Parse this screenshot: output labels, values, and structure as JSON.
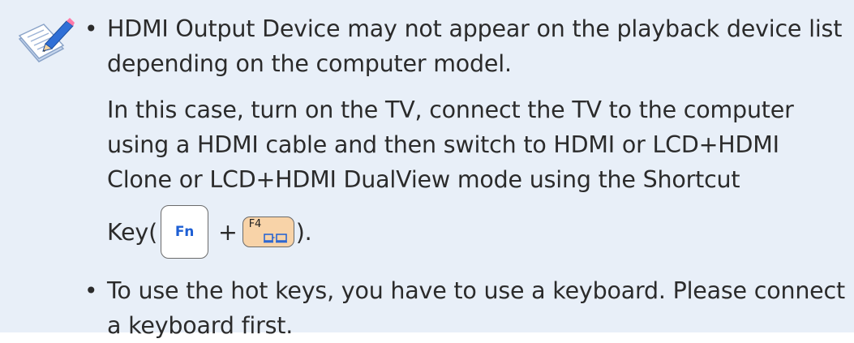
{
  "note": {
    "icon": "note-pencil-icon",
    "colors": {
      "background": "#e8eff8",
      "text": "#2b2b2b",
      "fn_key_text": "#1e5fd4",
      "f4_key_fill": "#f8d3a8"
    },
    "bullet_symbol": "•",
    "items": [
      {
        "text": "HDMI Output Device may not appear on the playback device list depending on the computer model.",
        "detail": "In this case, turn on the TV, connect the TV to the computer using a HDMI cable and then switch to HDMI or LCD+HDMI Clone or LCD+HDMI DualView mode using the Shortcut",
        "key_prefix": "Key(",
        "fn_key": "Fn",
        "plus": "+",
        "f4_key": "F4",
        "f4_key_icon": "display-switch-icon",
        "key_suffix": ")."
      },
      {
        "text": "To use the hot keys, you have to use a keyboard. Please connect a keyboard first."
      }
    ]
  }
}
